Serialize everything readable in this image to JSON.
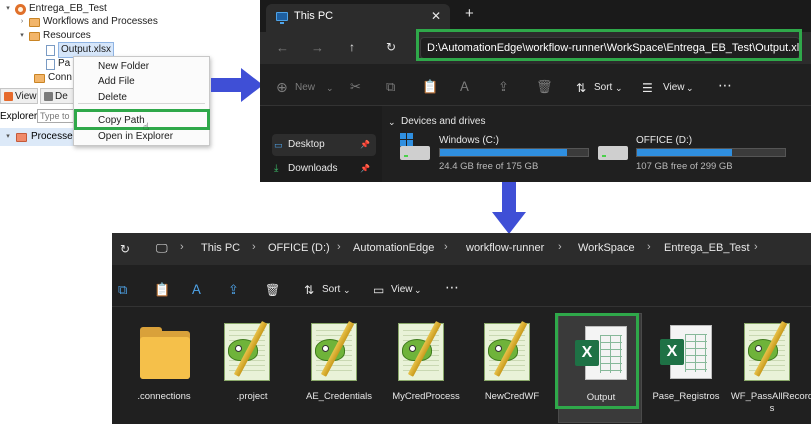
{
  "eclipse": {
    "tree": {
      "project": "Entrega_EB_Test",
      "workflows": "Workflows and Processes",
      "resources": "Resources",
      "selected_file": "Output.xlsx",
      "partial_item_1": "Pa",
      "partial_item_2": "Conn"
    },
    "context_menu": {
      "new_folder": "New Folder",
      "add_file": "Add File",
      "delete": "Delete",
      "copy_path": "Copy Path",
      "open_in_explorer": "Open in Explorer"
    },
    "tabs": {
      "view": "View",
      "partial": "De"
    },
    "explorer_label": "Explorer",
    "filter_placeholder": "Type to",
    "processes_label": "Processe"
  },
  "explorer_top": {
    "tab_title": "This PC",
    "address": "D:\\AutomationEdge\\workflow-runner\\WorkSpace\\Entrega_EB_Test\\Output.xlsx",
    "new_label": "New",
    "sort_label": "Sort",
    "view_label": "View",
    "sidebar": [
      {
        "label": "Desktop"
      },
      {
        "label": "Downloads"
      }
    ],
    "section_title": "Devices and drives",
    "drives": [
      {
        "name": "Windows (C:)",
        "free": "24.4 GB free of 175 GB",
        "used_fraction": 0.86
      },
      {
        "name": "OFFICE (D:)",
        "free": "107 GB free of 299 GB",
        "used_fraction": 0.64
      }
    ]
  },
  "explorer_bottom": {
    "breadcrumb": [
      "This PC",
      "OFFICE (D:)",
      "AutomationEdge",
      "workflow-runner",
      "WorkSpace",
      "Entrega_EB_Test"
    ],
    "sort_label": "Sort",
    "view_label": "View",
    "files": [
      {
        "name": ".connections",
        "type": "folder"
      },
      {
        "name": ".project",
        "type": "notepad"
      },
      {
        "name": "AE_Credentials",
        "type": "notepad"
      },
      {
        "name": "MyCredProcess",
        "type": "notepad"
      },
      {
        "name": "NewCredWF",
        "type": "notepad"
      },
      {
        "name": "Output",
        "type": "excel"
      },
      {
        "name": "Pase_Registros",
        "type": "excel"
      },
      {
        "name": "WF_PassAllRecords",
        "type": "notepad"
      }
    ]
  },
  "colors": {
    "highlight_green": "#2fa84a",
    "arrow_blue": "#3f4fd6",
    "progress_blue": "#2f8fe0"
  }
}
